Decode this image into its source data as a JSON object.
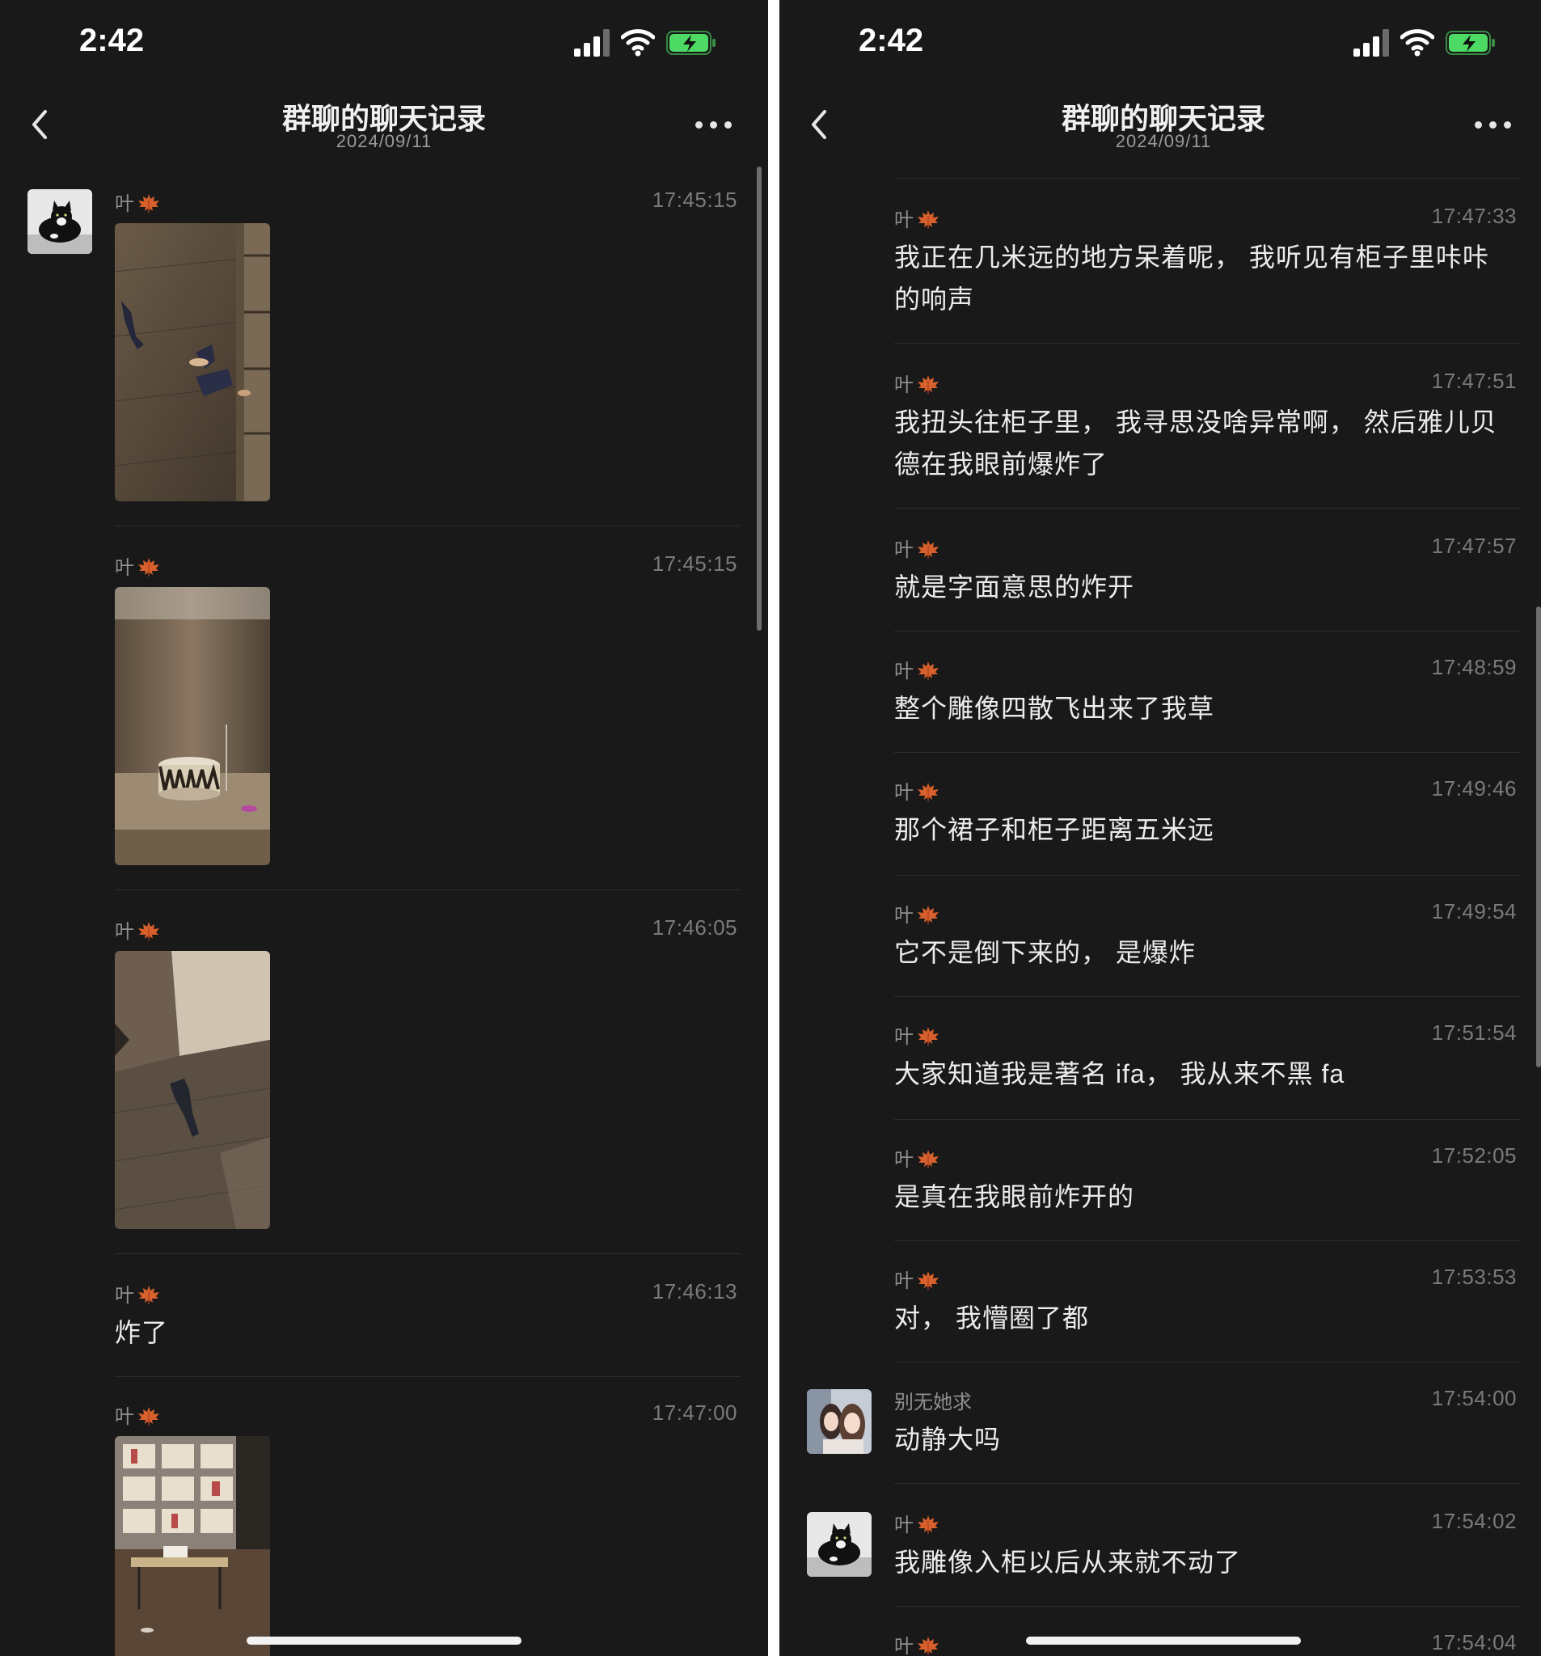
{
  "status_bar": {
    "time": "2:42"
  },
  "header": {
    "title": "群聊的聊天记录",
    "date": "2024/09/11"
  },
  "left_messages": [
    {
      "sender": "叶",
      "time": "17:45:15",
      "image": "wood floor with scattered sculpture fragments"
    },
    {
      "sender": "叶",
      "time": "17:45:15",
      "image": "cabinet shelf with cylindrical base"
    },
    {
      "sender": "叶",
      "time": "17:46:05",
      "image": "floor with fallen fragment"
    },
    {
      "sender": "叶",
      "time": "17:46:13",
      "text": "炸了"
    },
    {
      "sender": "叶",
      "time": "17:47:00",
      "image": "room with shelves and table"
    }
  ],
  "right_messages": [
    {
      "sender": "叶",
      "time": "17:47:33",
      "text": "我正在几米远的地方呆着呢， 我听见有柜子里咔咔的响声"
    },
    {
      "sender": "叶",
      "time": "17:47:51",
      "text": "我扭头往柜子里， 我寻思没啥异常啊， 然后雅儿贝德在我眼前爆炸了"
    },
    {
      "sender": "叶",
      "time": "17:47:57",
      "text": "就是字面意思的炸开"
    },
    {
      "sender": "叶",
      "time": "17:48:59",
      "text": "整个雕像四散飞出来了我草"
    },
    {
      "sender": "叶",
      "time": "17:49:46",
      "text": "那个裙子和柜子距离五米远"
    },
    {
      "sender": "叶",
      "time": "17:49:54",
      "text": "它不是倒下来的， 是爆炸"
    },
    {
      "sender": "叶",
      "time": "17:51:54",
      "text": "大家知道我是著名 ifa， 我从来不黑 fa"
    },
    {
      "sender": "叶",
      "time": "17:52:05",
      "text": "是真在我眼前炸开的"
    },
    {
      "sender": "叶",
      "time": "17:53:53",
      "text": "对， 我懵圈了都"
    },
    {
      "sender": "别无她求",
      "time": "17:54:00",
      "text": "动静大吗"
    },
    {
      "sender": "叶",
      "time": "17:54:02",
      "text": "我雕像入柜以后从来就不动了"
    },
    {
      "sender": "叶",
      "time": "17:54:04",
      "text": ""
    }
  ],
  "icons": {
    "back": "chevron-left-icon",
    "more": "more-dots-icon",
    "sender_emoji": "maple-leaf-icon",
    "signal": "cellular-signal-icon",
    "wifi": "wifi-icon",
    "battery": "battery-charging-icon"
  },
  "colors": {
    "background": "#191919",
    "battery": "#4cd964",
    "timestamp": "#7a7a7a"
  }
}
